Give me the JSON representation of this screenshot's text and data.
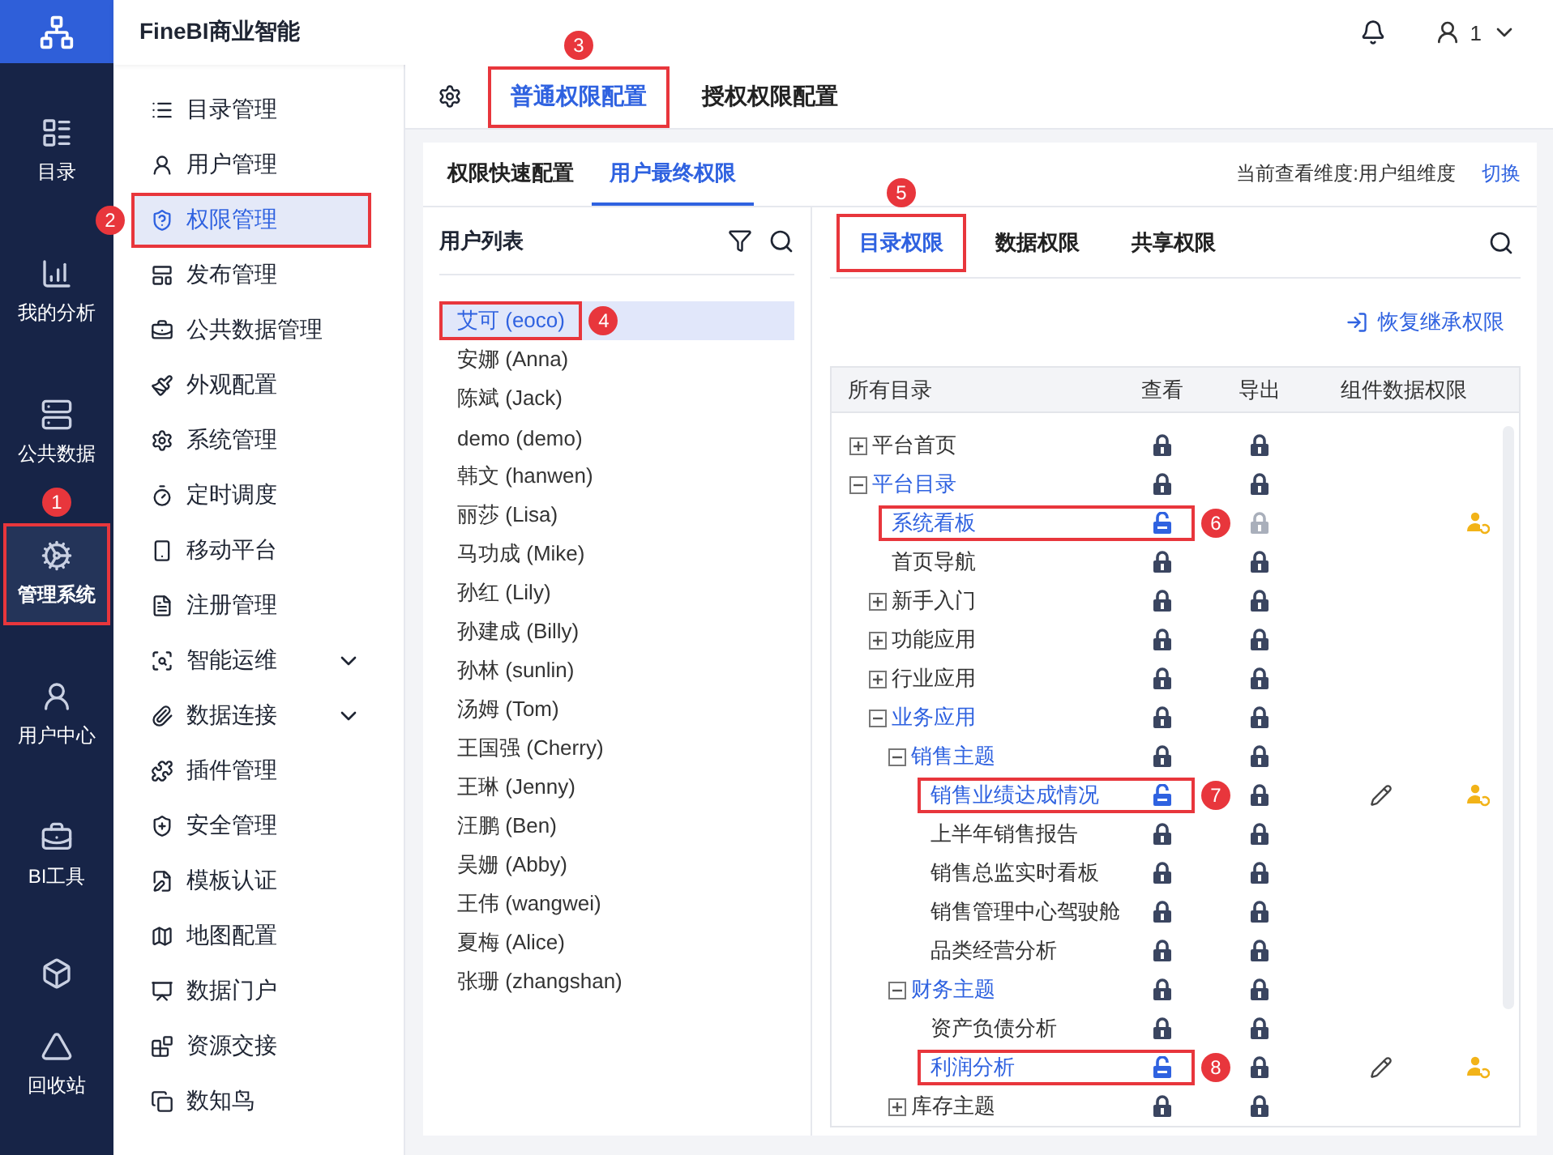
{
  "app": {
    "title": "FineBI商业智能"
  },
  "header": {
    "user": "1"
  },
  "rail": [
    {
      "label": "目录",
      "selected": false
    },
    {
      "label": "我的分析",
      "selected": false
    },
    {
      "label": "公共数据",
      "selected": false
    },
    {
      "label": "管理系统",
      "selected": true,
      "callout": "1"
    },
    {
      "label": "用户中心",
      "selected": false
    },
    {
      "label": "BI工具",
      "selected": false
    },
    {
      "selected": false
    },
    {
      "label": "回收站",
      "selected": false
    }
  ],
  "menu": [
    {
      "label": "目录管理",
      "kind": "page",
      "selected": false
    },
    {
      "label": "用户管理",
      "kind": "page",
      "selected": false
    },
    {
      "label": "权限管理",
      "kind": "page",
      "selected": true,
      "callout": "2"
    },
    {
      "label": "发布管理",
      "kind": "page",
      "selected": false
    },
    {
      "label": "公共数据管理",
      "kind": "page",
      "selected": false
    },
    {
      "label": "外观配置",
      "kind": "page",
      "selected": false
    },
    {
      "label": "系统管理",
      "kind": "page",
      "selected": false
    },
    {
      "label": "定时调度",
      "kind": "page",
      "selected": false
    },
    {
      "label": "移动平台",
      "kind": "page",
      "selected": false
    },
    {
      "label": "注册管理",
      "kind": "page",
      "selected": false
    },
    {
      "label": "智能运维",
      "kind": "group",
      "selected": false,
      "expanded": false
    },
    {
      "label": "数据连接",
      "kind": "group",
      "selected": false,
      "expanded": false
    },
    {
      "label": "插件管理",
      "kind": "page",
      "selected": false
    },
    {
      "label": "安全管理",
      "kind": "page",
      "selected": false
    },
    {
      "label": "模板认证",
      "kind": "page",
      "selected": false
    },
    {
      "label": "地图配置",
      "kind": "page",
      "selected": false
    },
    {
      "label": "数据门户",
      "kind": "page",
      "selected": false
    },
    {
      "label": "资源交接",
      "kind": "page",
      "selected": false
    },
    {
      "label": "数知鸟",
      "kind": "page",
      "selected": false
    }
  ],
  "top_tabs": [
    {
      "label": "普通权限配置",
      "selected": true,
      "callout": "3"
    },
    {
      "label": "授权权限配置",
      "selected": false
    }
  ],
  "sub_tabs": [
    {
      "label": "权限快速配置",
      "selected": false
    },
    {
      "label": "用户最终权限",
      "selected": true
    }
  ],
  "dimension": {
    "text": "当前查看维度:用户组维度",
    "action": "切换"
  },
  "user_list": {
    "title": "用户列表",
    "users": [
      {
        "name": "艾可 (eoco)",
        "selected": true,
        "callout": "4"
      },
      {
        "name": "安娜 (Anna)",
        "selected": false
      },
      {
        "name": "陈斌 (Jack)",
        "selected": false
      },
      {
        "name": "demo (demo)",
        "selected": false
      },
      {
        "name": "韩文 (hanwen)",
        "selected": false
      },
      {
        "name": "丽莎 (Lisa)",
        "selected": false
      },
      {
        "name": "马功成 (Mike)",
        "selected": false
      },
      {
        "name": "孙红 (Lily)",
        "selected": false
      },
      {
        "name": "孙建成 (Billy)",
        "selected": false
      },
      {
        "name": "孙林 (sunlin)",
        "selected": false
      },
      {
        "name": "汤姆 (Tom)",
        "selected": false
      },
      {
        "name": "王国强 (Cherry)",
        "selected": false
      },
      {
        "name": "王琳 (Jenny)",
        "selected": false
      },
      {
        "name": "汪鹏 (Ben)",
        "selected": false
      },
      {
        "name": "吴姗 (Abby)",
        "selected": false
      },
      {
        "name": "王伟 (wangwei)",
        "selected": false
      },
      {
        "name": "夏梅 (Alice)",
        "selected": false
      },
      {
        "name": "张珊 (zhangshan)",
        "selected": false
      }
    ]
  },
  "permission_tabs": [
    {
      "label": "目录权限",
      "selected": true,
      "callout": "5"
    },
    {
      "label": "数据权限",
      "selected": false
    },
    {
      "label": "共享权限",
      "selected": false
    }
  ],
  "restore_action": "恢复继承权限",
  "tree": {
    "columns": [
      "所有目录",
      "查看",
      "导出",
      "组件数据权限"
    ],
    "nodes": [
      {
        "name": "平台首页",
        "expanded": false,
        "active": false,
        "view_open": false,
        "export_open": false,
        "export_disabled": false,
        "edit": false,
        "user_rule": false
      },
      {
        "name": "平台目录",
        "expanded": true,
        "active": true,
        "view_open": false,
        "export_open": false,
        "export_disabled": false,
        "edit": false,
        "user_rule": false,
        "children": [
          {
            "name": "系统看板",
            "active": true,
            "view_open": true,
            "export_open": false,
            "export_disabled": true,
            "edit": false,
            "user_rule": true,
            "callout": "6"
          },
          {
            "name": "首页导航",
            "active": false,
            "view_open": false,
            "export_open": false,
            "export_disabled": false,
            "edit": false,
            "user_rule": false
          },
          {
            "name": "新手入门",
            "expanded": false,
            "active": false,
            "view_open": false,
            "export_open": false,
            "export_disabled": false,
            "edit": false,
            "user_rule": false
          },
          {
            "name": "功能应用",
            "expanded": false,
            "active": false,
            "view_open": false,
            "export_open": false,
            "export_disabled": false,
            "edit": false,
            "user_rule": false
          },
          {
            "name": "行业应用",
            "expanded": false,
            "active": false,
            "view_open": false,
            "export_open": false,
            "export_disabled": false,
            "edit": false,
            "user_rule": false
          },
          {
            "name": "业务应用",
            "expanded": true,
            "active": true,
            "view_open": false,
            "export_open": false,
            "export_disabled": false,
            "edit": false,
            "user_rule": false,
            "children": [
              {
                "name": "销售主题",
                "expanded": true,
                "active": true,
                "view_open": false,
                "export_open": false,
                "export_disabled": false,
                "edit": false,
                "user_rule": false,
                "children": [
                  {
                    "name": "销售业绩达成情况",
                    "active": true,
                    "view_open": true,
                    "export_open": false,
                    "export_disabled": false,
                    "edit": true,
                    "user_rule": true,
                    "callout": "7"
                  },
                  {
                    "name": "上半年销售报告",
                    "active": false,
                    "view_open": false,
                    "export_open": false,
                    "export_disabled": false,
                    "edit": false,
                    "user_rule": false
                  },
                  {
                    "name": "销售总监实时看板",
                    "active": false,
                    "view_open": false,
                    "export_open": false,
                    "export_disabled": false,
                    "edit": false,
                    "user_rule": false
                  },
                  {
                    "name": "销售管理中心驾驶舱",
                    "active": false,
                    "view_open": false,
                    "export_open": false,
                    "export_disabled": false,
                    "edit": false,
                    "user_rule": false
                  },
                  {
                    "name": "品类经营分析",
                    "active": false,
                    "view_open": false,
                    "export_open": false,
                    "export_disabled": false,
                    "edit": false,
                    "user_rule": false
                  }
                ]
              },
              {
                "name": "财务主题",
                "expanded": true,
                "active": true,
                "view_open": false,
                "export_open": false,
                "export_disabled": false,
                "edit": false,
                "user_rule": false,
                "children": [
                  {
                    "name": "资产负债分析",
                    "active": false,
                    "view_open": false,
                    "export_open": false,
                    "export_disabled": false,
                    "edit": false,
                    "user_rule": false
                  },
                  {
                    "name": "利润分析",
                    "active": true,
                    "view_open": true,
                    "export_open": false,
                    "export_disabled": false,
                    "edit": true,
                    "user_rule": true,
                    "callout": "8"
                  }
                ]
              },
              {
                "name": "库存主题",
                "expanded": false,
                "active": false,
                "view_open": false,
                "export_open": false,
                "export_disabled": false,
                "edit": false,
                "user_rule": false
              }
            ]
          }
        ]
      }
    ]
  }
}
